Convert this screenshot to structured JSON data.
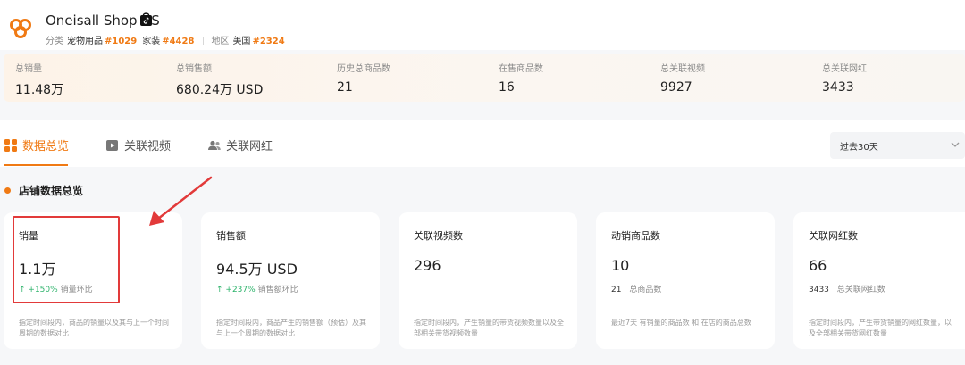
{
  "shop": {
    "name": "Oneisall Shop US",
    "category_label": "分类",
    "category1": "宠物用品",
    "rank1": "#1029",
    "category2": "家装",
    "rank2": "#4428",
    "region_label": "地区",
    "region": "美国",
    "rank3": "#2324"
  },
  "stats": [
    {
      "label": "总销量",
      "value": "11.48万"
    },
    {
      "label": "总销售额",
      "value": "680.24万 USD"
    },
    {
      "label": "历史总商品数",
      "value": "21"
    },
    {
      "label": "在售商品数",
      "value": "16"
    },
    {
      "label": "总关联视频",
      "value": "9927"
    },
    {
      "label": "总关联网红",
      "value": "3433"
    }
  ],
  "tabs": [
    {
      "label": "数据总览",
      "icon": "grid-icon",
      "active": true
    },
    {
      "label": "关联视频",
      "icon": "video-icon",
      "active": false
    },
    {
      "label": "关联网红",
      "icon": "users-icon",
      "active": false
    }
  ],
  "range": {
    "selected": "过去30天"
  },
  "section": {
    "title": "店铺数据总览"
  },
  "cards": [
    {
      "title": "销量",
      "value": "1.1万",
      "change": "↑ +150%",
      "change_label": "销量环比",
      "desc": "指定时间段内，商品的销量以及其与上一个时间周期的数据对比"
    },
    {
      "title": "销售额",
      "value": "94.5万 USD",
      "change": "↑ +237%",
      "change_label": "销售额环比",
      "desc": "指定时间段内，商品产生的销售额（预估）及其与上一个周期的数据对比"
    },
    {
      "title": "关联视频数",
      "value": "296",
      "change": "",
      "change_label": "",
      "desc": "指定时间段内，产生销量的带货视频数量以及全部相关带货视频数量"
    },
    {
      "title": "动销商品数",
      "value": "10",
      "change": "21",
      "change_label": "总商品数",
      "desc": "最近7天 有销量的商品数 和 在店的商品总数"
    },
    {
      "title": "关联网红数",
      "value": "66",
      "change": "3433",
      "change_label": "总关联网红数",
      "desc": "指定时间段内，产生带货销量的网红数量，以及全部相关带货网红数量"
    }
  ],
  "colors": {
    "accent": "#f07a14",
    "up": "#2db36b",
    "annotation": "#e23a3a"
  }
}
